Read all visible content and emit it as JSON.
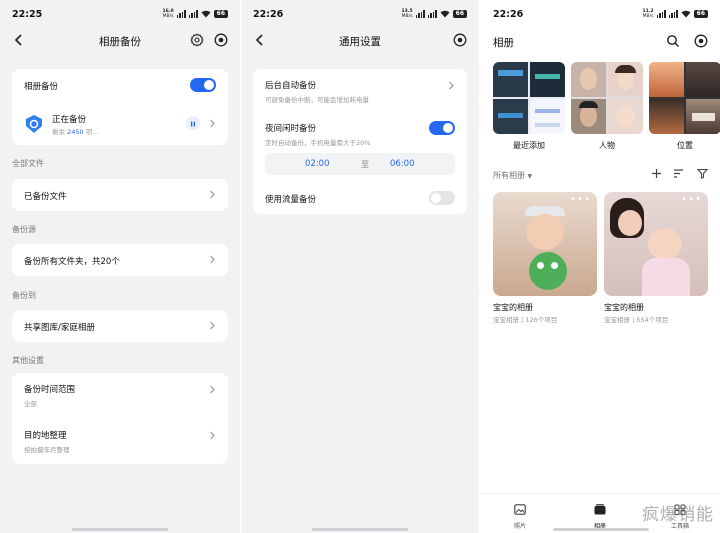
{
  "phone1": {
    "time": "22:25",
    "net_speed": "16.0",
    "net_unit": "MB/s",
    "battery": "66",
    "title": "相册备份",
    "album_backup_label": "相册备份",
    "backing_up_label": "正在备份",
    "remaining_prefix": "剩余",
    "remaining_count": "2450",
    "remaining_suffix": "项...",
    "section_all_files": "全部文件",
    "backed_up_files": "已备份文件",
    "section_backup_source": "备份源",
    "backup_all_folders": "备份所有文件夹，共20个",
    "section_backup_to": "备份到",
    "shared_library": "共享图库/家庭相册",
    "section_other": "其他设置",
    "time_range_label": "备份时间范围",
    "time_range_value": "全部",
    "dest_label": "目的地整理",
    "dest_value": "按拍摄年月整理"
  },
  "phone2": {
    "time": "22:26",
    "net_speed": "13.5",
    "net_unit": "MB/s",
    "battery": "66",
    "title": "通用设置",
    "bg_backup_label": "后台自动备份",
    "bg_backup_sub": "可避免备份中断，可能会增加耗电量",
    "night_backup_label": "夜间闲时备份",
    "night_backup_sub": "定时自动备份，手机电量需大于20%",
    "start_time": "02:00",
    "to": "至",
    "end_time": "06:00",
    "mobile_data_label": "使用流量备份"
  },
  "phone3": {
    "time": "22:26",
    "net_speed": "11.2",
    "net_unit": "MB/s",
    "battery": "66",
    "title": "相册",
    "recent_label": "最近添加",
    "people_label": "人物",
    "places_label": "位置",
    "all_albums_label": "所有相册",
    "albums": [
      {
        "title": "宝宝的相册",
        "sub": "宝宝相册 | 126个项目"
      },
      {
        "title": "宝宝的相册",
        "sub": "宝宝相册 | 554个项目"
      }
    ],
    "tabs": [
      "照片",
      "相册",
      "工具箱"
    ],
    "watermark": "疯爆销能"
  },
  "colors": {
    "accent": "#2468f2",
    "bg": "#f2f2f4"
  }
}
